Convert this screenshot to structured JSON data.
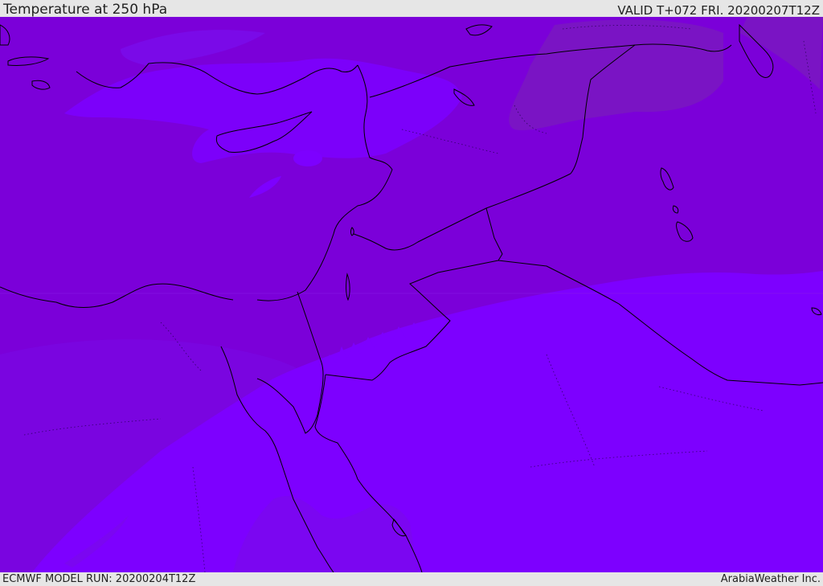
{
  "header": {
    "title": "Temperature at 250 hPa",
    "valid": "VALID T+072 FRI. 20200207T12Z"
  },
  "footer": {
    "model_run": "ECMWF MODEL RUN: 20200204T12Z",
    "brand": "ArabiaWeather Inc."
  },
  "map": {
    "region": "Eastern Mediterranean / Middle East",
    "colors": {
      "deep_violet": "#7b00d9",
      "mid_violet": "#7a0ae8",
      "bright_violet": "#7d00ff",
      "warm_purple": "#7a14c4",
      "coastline": "#000000"
    }
  }
}
